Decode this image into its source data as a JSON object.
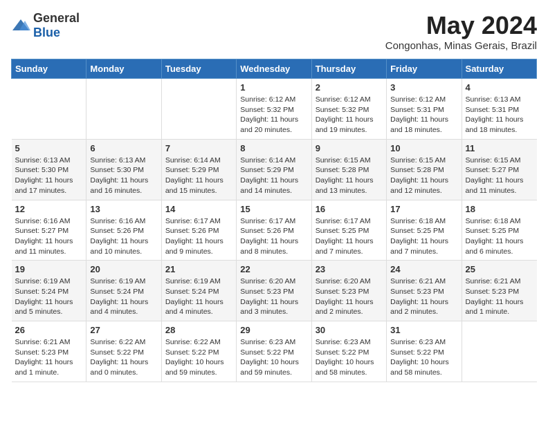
{
  "header": {
    "logo_general": "General",
    "logo_blue": "Blue",
    "title": "May 2024",
    "subtitle": "Congonhas, Minas Gerais, Brazil"
  },
  "columns": [
    "Sunday",
    "Monday",
    "Tuesday",
    "Wednesday",
    "Thursday",
    "Friday",
    "Saturday"
  ],
  "weeks": [
    [
      {
        "day": "",
        "info": ""
      },
      {
        "day": "",
        "info": ""
      },
      {
        "day": "",
        "info": ""
      },
      {
        "day": "1",
        "info": "Sunrise: 6:12 AM\nSunset: 5:32 PM\nDaylight: 11 hours\nand 20 minutes."
      },
      {
        "day": "2",
        "info": "Sunrise: 6:12 AM\nSunset: 5:32 PM\nDaylight: 11 hours\nand 19 minutes."
      },
      {
        "day": "3",
        "info": "Sunrise: 6:12 AM\nSunset: 5:31 PM\nDaylight: 11 hours\nand 18 minutes."
      },
      {
        "day": "4",
        "info": "Sunrise: 6:13 AM\nSunset: 5:31 PM\nDaylight: 11 hours\nand 18 minutes."
      }
    ],
    [
      {
        "day": "5",
        "info": "Sunrise: 6:13 AM\nSunset: 5:30 PM\nDaylight: 11 hours\nand 17 minutes."
      },
      {
        "day": "6",
        "info": "Sunrise: 6:13 AM\nSunset: 5:30 PM\nDaylight: 11 hours\nand 16 minutes."
      },
      {
        "day": "7",
        "info": "Sunrise: 6:14 AM\nSunset: 5:29 PM\nDaylight: 11 hours\nand 15 minutes."
      },
      {
        "day": "8",
        "info": "Sunrise: 6:14 AM\nSunset: 5:29 PM\nDaylight: 11 hours\nand 14 minutes."
      },
      {
        "day": "9",
        "info": "Sunrise: 6:15 AM\nSunset: 5:28 PM\nDaylight: 11 hours\nand 13 minutes."
      },
      {
        "day": "10",
        "info": "Sunrise: 6:15 AM\nSunset: 5:28 PM\nDaylight: 11 hours\nand 12 minutes."
      },
      {
        "day": "11",
        "info": "Sunrise: 6:15 AM\nSunset: 5:27 PM\nDaylight: 11 hours\nand 11 minutes."
      }
    ],
    [
      {
        "day": "12",
        "info": "Sunrise: 6:16 AM\nSunset: 5:27 PM\nDaylight: 11 hours\nand 11 minutes."
      },
      {
        "day": "13",
        "info": "Sunrise: 6:16 AM\nSunset: 5:26 PM\nDaylight: 11 hours\nand 10 minutes."
      },
      {
        "day": "14",
        "info": "Sunrise: 6:17 AM\nSunset: 5:26 PM\nDaylight: 11 hours\nand 9 minutes."
      },
      {
        "day": "15",
        "info": "Sunrise: 6:17 AM\nSunset: 5:26 PM\nDaylight: 11 hours\nand 8 minutes."
      },
      {
        "day": "16",
        "info": "Sunrise: 6:17 AM\nSunset: 5:25 PM\nDaylight: 11 hours\nand 7 minutes."
      },
      {
        "day": "17",
        "info": "Sunrise: 6:18 AM\nSunset: 5:25 PM\nDaylight: 11 hours\nand 7 minutes."
      },
      {
        "day": "18",
        "info": "Sunrise: 6:18 AM\nSunset: 5:25 PM\nDaylight: 11 hours\nand 6 minutes."
      }
    ],
    [
      {
        "day": "19",
        "info": "Sunrise: 6:19 AM\nSunset: 5:24 PM\nDaylight: 11 hours\nand 5 minutes."
      },
      {
        "day": "20",
        "info": "Sunrise: 6:19 AM\nSunset: 5:24 PM\nDaylight: 11 hours\nand 4 minutes."
      },
      {
        "day": "21",
        "info": "Sunrise: 6:19 AM\nSunset: 5:24 PM\nDaylight: 11 hours\nand 4 minutes."
      },
      {
        "day": "22",
        "info": "Sunrise: 6:20 AM\nSunset: 5:23 PM\nDaylight: 11 hours\nand 3 minutes."
      },
      {
        "day": "23",
        "info": "Sunrise: 6:20 AM\nSunset: 5:23 PM\nDaylight: 11 hours\nand 2 minutes."
      },
      {
        "day": "24",
        "info": "Sunrise: 6:21 AM\nSunset: 5:23 PM\nDaylight: 11 hours\nand 2 minutes."
      },
      {
        "day": "25",
        "info": "Sunrise: 6:21 AM\nSunset: 5:23 PM\nDaylight: 11 hours\nand 1 minute."
      }
    ],
    [
      {
        "day": "26",
        "info": "Sunrise: 6:21 AM\nSunset: 5:23 PM\nDaylight: 11 hours\nand 1 minute."
      },
      {
        "day": "27",
        "info": "Sunrise: 6:22 AM\nSunset: 5:22 PM\nDaylight: 11 hours\nand 0 minutes."
      },
      {
        "day": "28",
        "info": "Sunrise: 6:22 AM\nSunset: 5:22 PM\nDaylight: 10 hours\nand 59 minutes."
      },
      {
        "day": "29",
        "info": "Sunrise: 6:23 AM\nSunset: 5:22 PM\nDaylight: 10 hours\nand 59 minutes."
      },
      {
        "day": "30",
        "info": "Sunrise: 6:23 AM\nSunset: 5:22 PM\nDaylight: 10 hours\nand 58 minutes."
      },
      {
        "day": "31",
        "info": "Sunrise: 6:23 AM\nSunset: 5:22 PM\nDaylight: 10 hours\nand 58 minutes."
      },
      {
        "day": "",
        "info": ""
      }
    ]
  ]
}
